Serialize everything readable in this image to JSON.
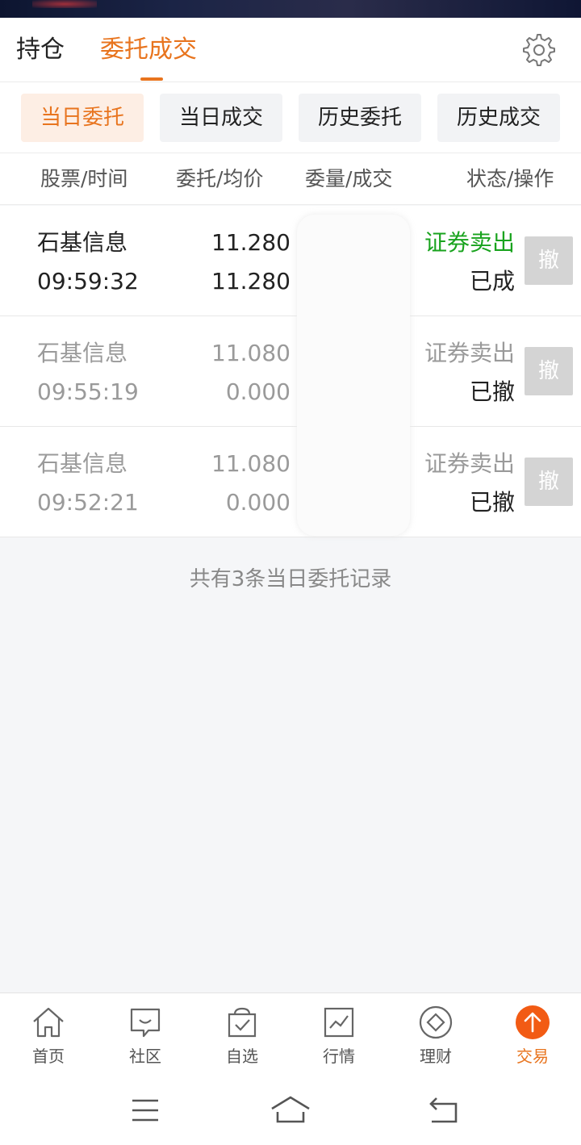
{
  "top_tabs": {
    "holdings": "持仓",
    "orders": "委托成交"
  },
  "sub_tabs": [
    "当日委托",
    "当日成交",
    "历史委托",
    "历史成交"
  ],
  "columns": {
    "stock_time": "股票/时间",
    "price_avg": "委托/均价",
    "qty_filled": "委量/成交",
    "status_action": "状态/操作"
  },
  "orders": [
    {
      "name": "石基信息",
      "time": "09:59:32",
      "price": "11.280",
      "avg": "11.280",
      "direction": "证券卖出",
      "state": "已成",
      "cancel": "撤"
    },
    {
      "name": "石基信息",
      "time": "09:55:19",
      "price": "11.080",
      "avg": "0.000",
      "direction": "证券卖出",
      "state": "已撤",
      "cancel": "撤"
    },
    {
      "name": "石基信息",
      "time": "09:52:21",
      "price": "11.080",
      "avg": "0.000",
      "direction": "证券卖出",
      "state": "已撤",
      "cancel": "撤"
    }
  ],
  "summary": "共有3条当日委托记录",
  "bottom_nav": [
    {
      "label": "首页",
      "icon": "home-icon"
    },
    {
      "label": "社区",
      "icon": "chat-icon"
    },
    {
      "label": "自选",
      "icon": "watchlist-check-icon"
    },
    {
      "label": "行情",
      "icon": "chart-icon"
    },
    {
      "label": "理财",
      "icon": "diamond-icon"
    },
    {
      "label": "交易",
      "icon": "trade-up-arrow-icon"
    }
  ],
  "colors": {
    "accent": "#e8741e",
    "sell_green": "#19a31e",
    "muted": "#9a9a9a"
  }
}
